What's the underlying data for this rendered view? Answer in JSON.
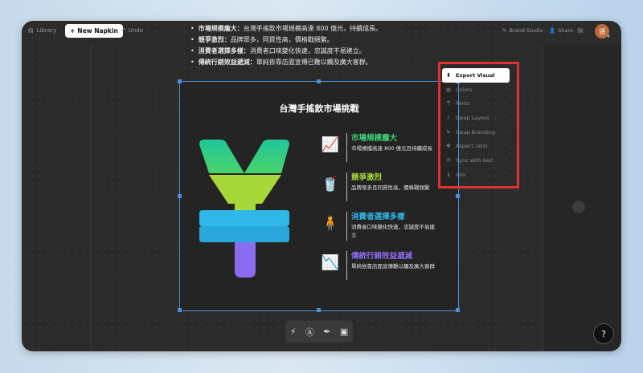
{
  "topbar": {
    "library_label": "Library",
    "new_napkin_label": "New Napkin",
    "undo_label": "Undo",
    "brand_studio_label": "Brand Studio",
    "share_label": "Share",
    "avatar_initial": "領"
  },
  "bullets": [
    {
      "head": "市場規模龐大：",
      "body": "台灣手搖飲市場規模高達 800 億元，持續成長。"
    },
    {
      "head": "競爭激烈：",
      "body": "品牌眾多，同質性高，價格戰頻繁。"
    },
    {
      "head": "消費者選擇多樣：",
      "body": "消費者口味變化快速，忠誠度不易建立。"
    },
    {
      "head": "傳統行銷效益遞減：",
      "body": "單純依靠店面宣傳已難以觸及廣大客群。"
    }
  ],
  "card": {
    "title": "台灣手搖飲市場挑戰",
    "items": [
      {
        "heading": "市場規模龐大",
        "desc": "市場規模高達 800 億元且持續成長",
        "color": "#3fd27a",
        "icon": "chart-up-icon"
      },
      {
        "heading": "競爭激烈",
        "desc": "品牌眾多且同質性高，價格戰頻繁",
        "color": "#a6d83a",
        "icon": "drinks-icon"
      },
      {
        "heading": "消費者選擇多樣",
        "desc": "消費者口味變化快速，忠誠度不易建立",
        "color": "#2fb7e8",
        "icon": "person-drink-icon"
      },
      {
        "heading": "傳統行銷效益遞減",
        "desc": "單純依靠店面宣傳難以觸及廣大客群",
        "color": "#8b6cf0",
        "icon": "chart-down-icon"
      }
    ],
    "colors": {
      "teal": "#24c788",
      "lime": "#a6d83a",
      "cyan": "#2fb7e8",
      "purple": "#8b6cf0"
    }
  },
  "menu": {
    "items": [
      {
        "label": "Export Visual",
        "icon": "download-icon",
        "active": true
      },
      {
        "label": "Colors",
        "icon": "palette-icon"
      },
      {
        "label": "Fonts",
        "icon": "text-icon"
      },
      {
        "label": "Swap Layout",
        "icon": "bolt-icon"
      },
      {
        "label": "Swap Branding",
        "icon": "brush-icon"
      },
      {
        "label": "Aspect ratio",
        "icon": "move-icon"
      },
      {
        "label": "Sync with text",
        "icon": "sync-icon"
      },
      {
        "label": "Info",
        "icon": "info-icon"
      }
    ]
  },
  "help_label": "?"
}
